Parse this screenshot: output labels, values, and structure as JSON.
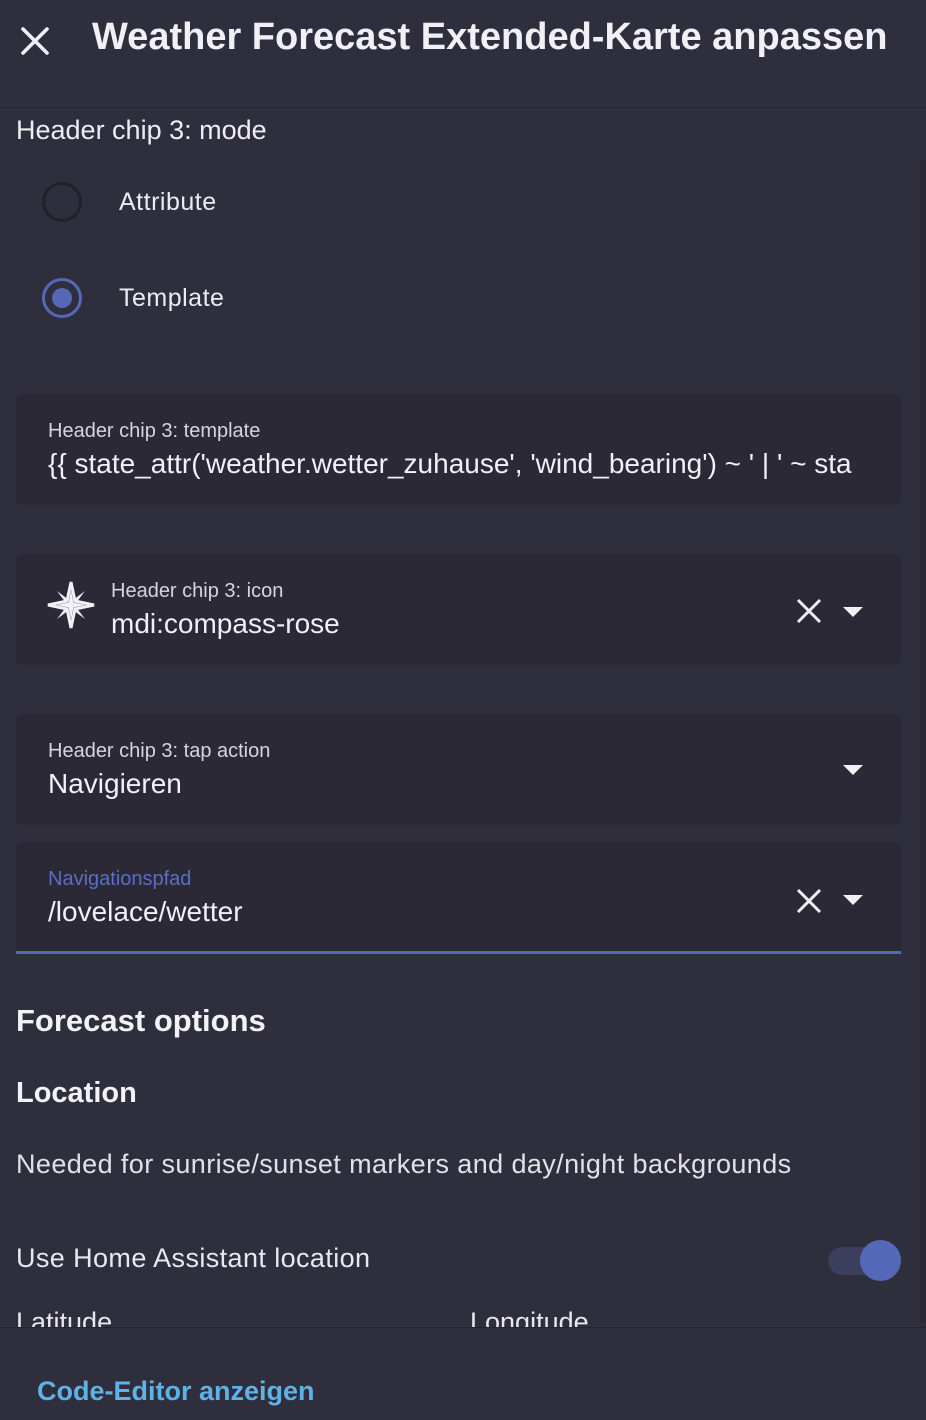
{
  "dialog": {
    "title": "Weather Forecast Extended-Karte anpassen",
    "close_icon": "close-icon"
  },
  "mode": {
    "label": "Header chip 3: mode",
    "options": [
      {
        "label": "Attribute",
        "selected": false
      },
      {
        "label": "Template",
        "selected": true
      }
    ]
  },
  "template_field": {
    "label": "Header chip 3: template",
    "value": "{{  state_attr('weather.wetter_zuhause', 'wind_bearing')  ~ ' | ' ~ sta"
  },
  "icon_field": {
    "label": "Header chip 3: icon",
    "value": "mdi:compass-rose",
    "icon": "compass-rose-icon"
  },
  "tap_action_field": {
    "label": "Header chip 3: tap action",
    "value": "Navigieren"
  },
  "navigation_field": {
    "label": "Navigationspfad",
    "value": "/lovelace/wetter"
  },
  "forecast": {
    "heading": "Forecast options",
    "location_heading": "Location",
    "location_description": "Needed for sunrise/sunset markers and day/night backgrounds",
    "use_ha_location_label": "Use Home Assistant location",
    "use_ha_location_on": true,
    "latitude_label": "Latitude",
    "longitude_label": "Longitude"
  },
  "footer": {
    "code_editor_label": "Code-Editor anzeigen"
  },
  "colors": {
    "background": "#2f2e3c",
    "field_background": "#2a2935",
    "accent": "#5568b8",
    "link": "#5fb2e6"
  }
}
